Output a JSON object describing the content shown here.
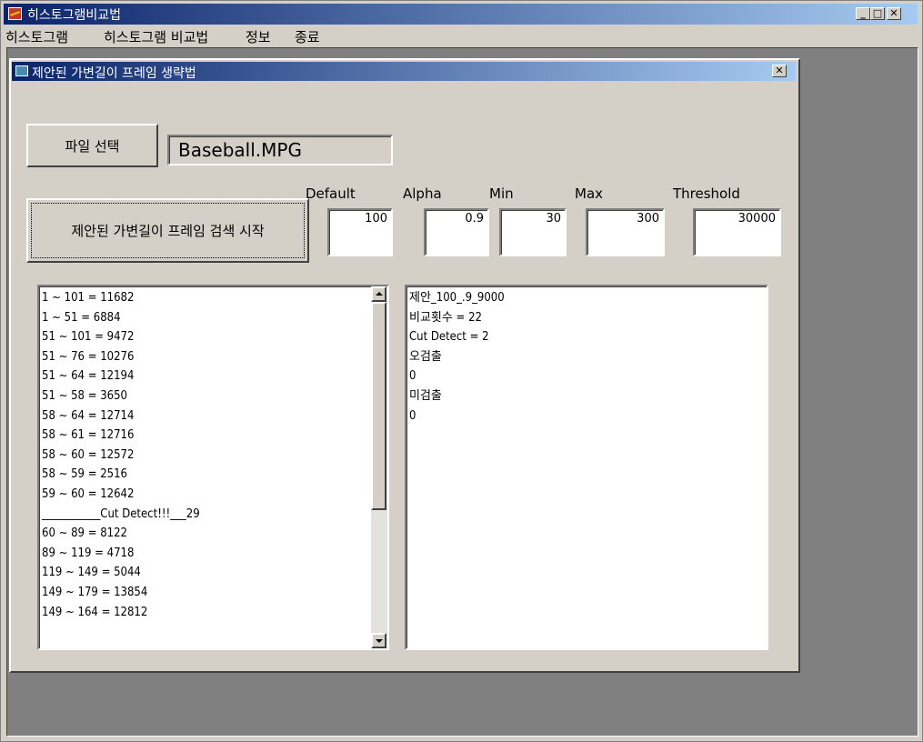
{
  "app": {
    "title": "히스토그램비교법"
  },
  "menu": [
    "히스토그램",
    "히스토그램 비교법",
    "정보",
    "종료"
  ],
  "dialog": {
    "title": "제안된 가변길이 프레임 생략법"
  },
  "file": {
    "button_label": "파일 선택",
    "filename": "Baseball.MPG"
  },
  "search": {
    "button_label": "제안된 가변길이 프레임 검색 시작"
  },
  "params": {
    "default": {
      "label": "Default",
      "value": "100"
    },
    "alpha": {
      "label": "Alpha",
      "value": "0.9"
    },
    "min": {
      "label": "Min",
      "value": "30"
    },
    "max": {
      "label": "Max",
      "value": "300"
    },
    "threshold": {
      "label": "Threshold",
      "value": "30000"
    }
  },
  "log_list": [
    "1 ~ 101 = 11682",
    "1 ~ 51 = 6884",
    "51 ~ 101 = 9472",
    "51 ~ 76 = 10276",
    "51 ~ 64 = 12194",
    "51 ~ 58 = 3650",
    "58 ~ 64 = 12714",
    "58 ~ 61 = 12716",
    "58 ~ 60 = 12572",
    "58 ~ 59 = 2516",
    "59 ~ 60 = 12642",
    "___________Cut Detect!!!___29",
    "60 ~ 89 = 8122",
    "89 ~ 119 = 4718",
    "119 ~ 149 = 5044",
    "149 ~ 179 = 13854",
    "149 ~ 164 = 12812"
  ],
  "result_list": [
    "제안_100_.9_9000",
    "비교횟수 = 22",
    "Cut Detect = 2",
    "오검출",
    "0",
    "미검출",
    "0"
  ],
  "scrollbar": {
    "position_fraction": 0.0,
    "visible_fraction": 0.63
  }
}
